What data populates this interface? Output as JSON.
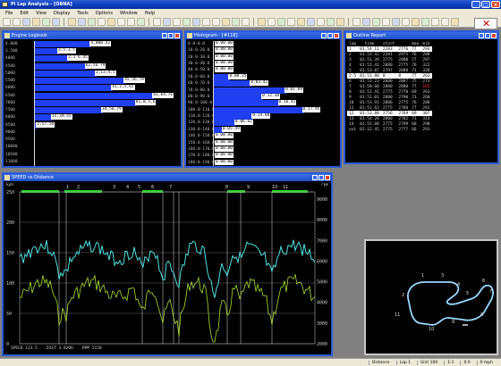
{
  "app": {
    "title": "Pi Lap Analysis - [OBNA]"
  },
  "menu": [
    "File",
    "Edit",
    "View",
    "Display",
    "Tools",
    "Options",
    "Window",
    "Help"
  ],
  "colors": {
    "bar": "#1f3ff0",
    "speed_trace": "#4fe0e0",
    "rpm_trace": "#a8e030",
    "marker": "#22dd22",
    "sel_row": "#ffffff",
    "red_value": "#ff3030"
  },
  "histogram_left": {
    "title": "Engine Logbook",
    "rows": [
      {
        "label": "4.000",
        "width": 0.46,
        "value": "4,000.42"
      },
      {
        "label": "3.500",
        "width": 0.2,
        "value": "3,5.3.5"
      },
      {
        "label": "4000",
        "width": 0.28,
        "value": "2,1 6,45"
      },
      {
        "label": "4500",
        "width": 0.42,
        "value": "62,56.79"
      },
      {
        "label": "5000",
        "width": 0.5,
        "value": "2,13,4,5"
      },
      {
        "label": "5500",
        "width": 0.73,
        "value": "45,56,79"
      },
      {
        "label": "6000",
        "width": 0.63,
        "value": "41,2,5,65"
      },
      {
        "label": "6500",
        "width": 0.96,
        "value": "61,64,76"
      },
      {
        "label": "7000",
        "width": 0.82,
        "value": "81,0,5,6"
      },
      {
        "label": "7500",
        "width": 0.55,
        "value": "34,56,79"
      },
      {
        "label": "8000",
        "width": 0.15,
        "value": "15,34,43"
      },
      {
        "label": "8500",
        "width": 0.03,
        "value": "2,57,50"
      },
      {
        "label": "9000",
        "width": 0.0,
        "value": ""
      },
      {
        "label": "9500",
        "width": 0.0,
        "value": ""
      },
      {
        "label": "10000",
        "width": 0.0,
        "value": ""
      },
      {
        "label": "10500",
        "width": 0.0,
        "value": ""
      },
      {
        "label": "11000",
        "width": 0.0,
        "value": ""
      }
    ]
  },
  "histogram_mid": {
    "title": "Histogram - [#118]",
    "rows": [
      {
        "label": "0.0-0.0",
        "width": 0.0,
        "value": "0.00.00"
      },
      {
        "label": "10.0-20.0",
        "width": 0.0,
        "value": "0.00.00"
      },
      {
        "label": "20.0-30.0",
        "width": 0.0,
        "value": "0.00.00"
      },
      {
        "label": "30.0-40.0",
        "width": 0.0,
        "value": "0.00.00"
      },
      {
        "label": "40.0-50.0",
        "width": 0.0,
        "value": "0.00.00"
      },
      {
        "label": "50.0-60.0",
        "width": 0.18,
        "value": "0.00.25"
      },
      {
        "label": "60.0-70.0",
        "width": 0.4,
        "value": "0.03.42"
      },
      {
        "label": "70.0-80.0",
        "width": 0.76,
        "value": "0.01.89"
      },
      {
        "label": "80.0-90.0",
        "width": 0.52,
        "value": "0.12.38"
      },
      {
        "label": "90.0-100.0",
        "width": 0.69,
        "value": "0.16.42"
      },
      {
        "label": "100.0-110.0",
        "width": 0.94,
        "value": "0.17.95"
      },
      {
        "label": "110.0-120.0",
        "width": 0.42,
        "value": "0.14.88"
      },
      {
        "label": "120.0-130.0",
        "width": 0.24,
        "value": "0.06.62"
      },
      {
        "label": "130.0-140.0",
        "width": 0.11,
        "value": "0.05.49"
      },
      {
        "label": "140.0-150.0",
        "width": 0.0,
        "value": "0.00.00"
      },
      {
        "label": "150.0-160.0",
        "width": 0.0,
        "value": "0.00.00"
      },
      {
        "label": "160.0-170.0",
        "width": 0.0,
        "value": "0.00.00"
      },
      {
        "label": "170.0-180.0",
        "width": 0.0,
        "value": "0.00.00"
      },
      {
        "label": "180.0-190.0",
        "width": 0.0,
        "value": "0.00.00"
      }
    ]
  },
  "lap_report": {
    "title": "Outline Report",
    "headers": [
      "lap",
      "time",
      "start",
      "",
      "max",
      "min"
    ],
    "rows": [
      {
        "cells": [
          "1",
          "01:54.11",
          "2283",
          "2776",
          "77",
          "293"
        ],
        "sel": true,
        "red": []
      },
      {
        "cells": [
          "2",
          "01:53.42",
          "2281",
          "2975",
          "76",
          "288"
        ],
        "sel": false,
        "red": []
      },
      {
        "cells": [
          "3",
          "01:51.39",
          "2775",
          "2880",
          "77",
          "297"
        ],
        "sel": false,
        "red": []
      },
      {
        "cells": [
          "4",
          "01:52.41",
          "2880",
          "2775",
          "76",
          "322"
        ],
        "sel": false,
        "red": []
      },
      {
        "cells": [
          "5",
          "01:53.87",
          "2797",
          "2888",
          "71",
          "328"
        ],
        "sel": false,
        "red": []
      },
      {
        "cells": [
          "2:5",
          "01:51.80",
          "0",
          "0",
          "77",
          "263"
        ],
        "sel": true,
        "red": []
      },
      {
        "cells": [
          "6",
          "01:53.23",
          "2880",
          "2887",
          "75",
          "273"
        ],
        "sel": false,
        "red": []
      },
      {
        "cells": [
          "7",
          "01:50.60",
          "2880",
          "2880",
          "77",
          "165"
        ],
        "sel": false,
        "red": [
          5
        ]
      },
      {
        "cells": [
          "8",
          "01:52.41",
          "2775",
          "2770",
          "69",
          "263"
        ],
        "sel": false,
        "red": []
      },
      {
        "cells": [
          "9",
          "01:51.01",
          "2880",
          "2790",
          "71",
          "268"
        ],
        "sel": false,
        "red": []
      },
      {
        "cells": [
          "10",
          "01:53.91",
          "2886",
          "2775",
          "76",
          "288"
        ],
        "sel": false,
        "red": []
      },
      {
        "cells": [
          "11",
          "01:52.62",
          "2775",
          "2780",
          "77",
          "291"
        ],
        "sel": false,
        "red": []
      },
      {
        "cells": [
          "12",
          "01:53.88",
          "2756",
          "2769",
          "69",
          "307"
        ],
        "sel": true,
        "red": []
      },
      {
        "cells": [
          "13",
          "01:54.20",
          "2800",
          "2782",
          "71",
          "314"
        ],
        "sel": false,
        "red": []
      },
      {
        "cells": [
          "14",
          "01:55.00",
          "2775",
          "2799",
          "68",
          "298"
        ],
        "sel": false,
        "red": []
      },
      {
        "cells": [
          "out",
          "02:12.45",
          "2775",
          "2777",
          "66",
          "291"
        ],
        "sel": false,
        "red": []
      }
    ]
  },
  "trace_panel": {
    "title": "SPEED vs Distance",
    "left_unit": "kph",
    "right_unit": "rpm",
    "y_left": [
      "250",
      "200",
      "150",
      "100",
      "50",
      "0"
    ],
    "y_right": [
      "9000",
      "8000",
      "7000",
      "6000",
      "5000",
      "4000",
      "3000",
      "2000"
    ],
    "segment_numbers": [
      "1",
      "2",
      "3",
      "4",
      "5",
      "6",
      "7",
      "8",
      "9",
      "10",
      "11"
    ],
    "footer_left": "SPEED  123.5",
    "footer_mid": "DIST  3.8206",
    "footer_right": "RPM  5150"
  },
  "track_map": {
    "title": "",
    "corner_labels": [
      "1",
      "2",
      "3",
      "4",
      "5",
      "6",
      "7",
      "8",
      "9",
      "10",
      "11"
    ]
  },
  "status": {
    "items": [
      "Distance",
      "Lap 1",
      "Unit 100",
      "1:1",
      "0.0",
      "0 mph"
    ]
  }
}
